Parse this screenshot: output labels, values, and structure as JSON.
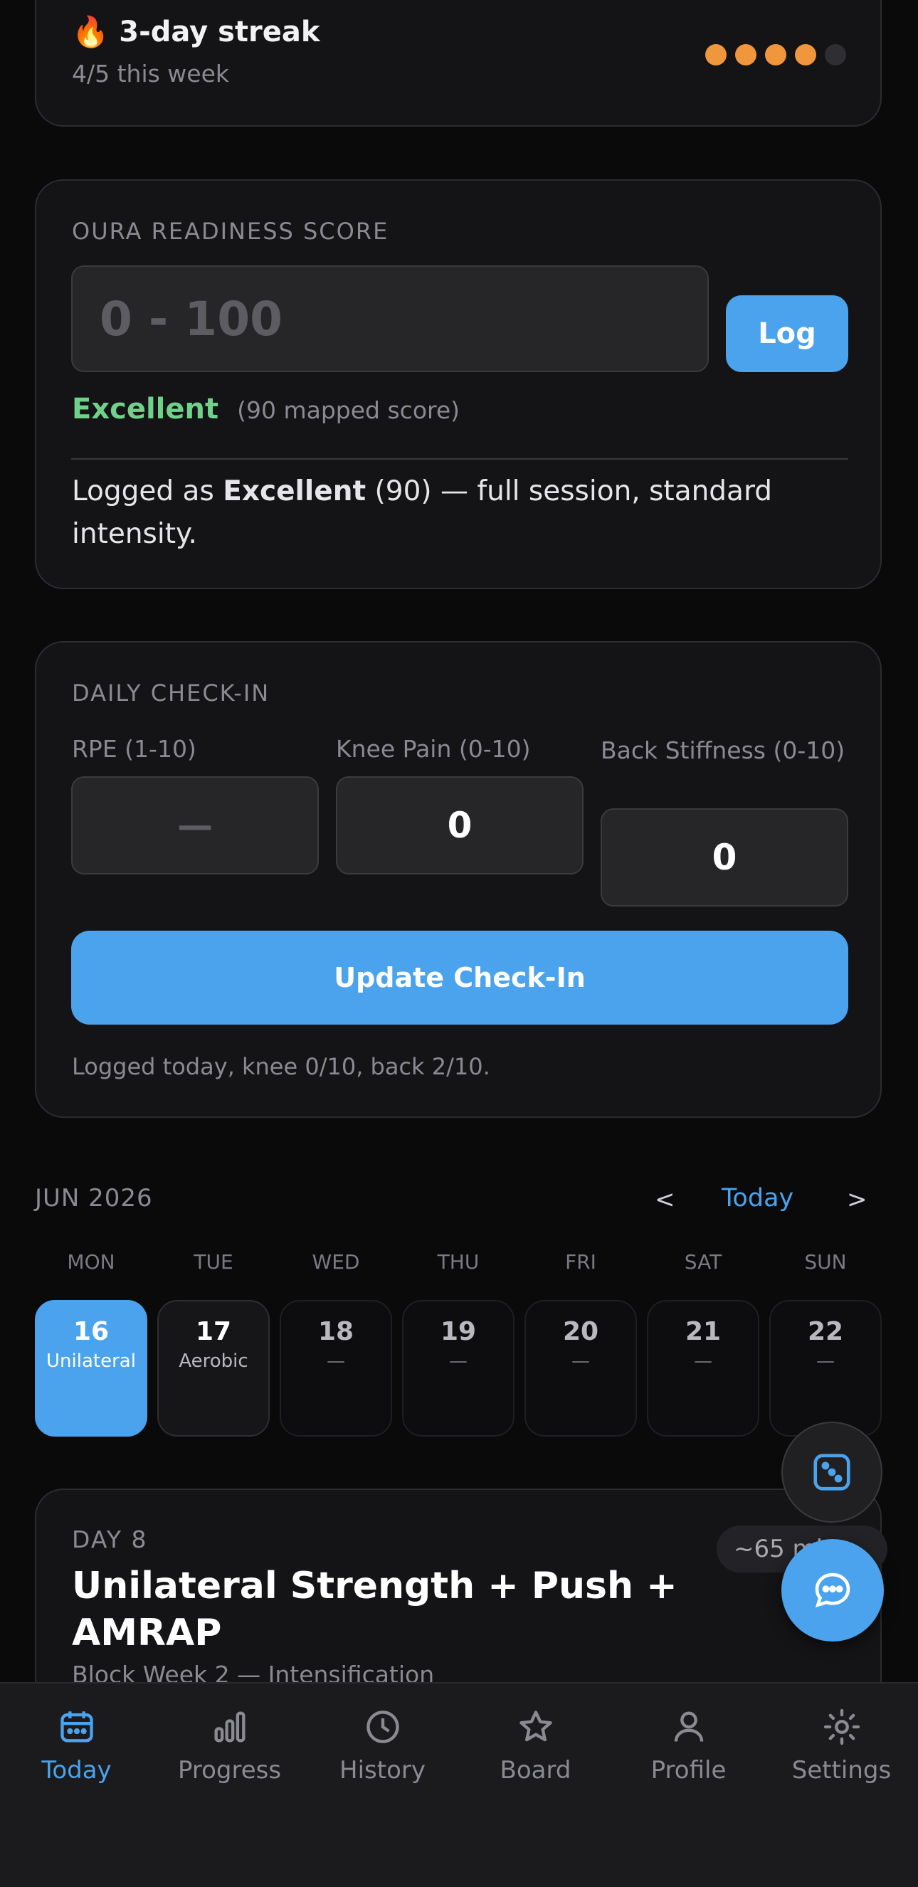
{
  "streak": {
    "emoji": "🔥",
    "title": "3-day streak",
    "subtitle": "4/5 this week",
    "dots_filled": 4,
    "dots_total": 5,
    "dot_color": "#f0963c"
  },
  "readiness": {
    "heading": "OURA READINESS SCORE",
    "input_placeholder": "0 - 100",
    "log_label": "Log",
    "rating": "Excellent",
    "rating_color": "#6fd18a",
    "mapped": "(90 mapped score)",
    "logged_prefix": "Logged as ",
    "logged_rating": "Excellent",
    "logged_suffix": " (90) — full session, standard intensity."
  },
  "checkin": {
    "heading": "DAILY CHECK-IN",
    "rpe_label": "RPE (1-10)",
    "rpe_value": "—",
    "knee_label": "Knee Pain (0-10)",
    "knee_value": "0",
    "back_label": "Back Stiffness (0-10)",
    "back_value": "0",
    "button_label": "Update Check-In",
    "status": "Logged today, knee 0/10, back 2/10."
  },
  "calendar": {
    "month": "JUN 2026",
    "prev": "<",
    "today_label": "Today",
    "next": ">",
    "weekdays": [
      "MON",
      "TUE",
      "WED",
      "THU",
      "FRI",
      "SAT",
      "SUN"
    ],
    "days": [
      {
        "num": "16",
        "sub": "Unilateral",
        "selected": true
      },
      {
        "num": "17",
        "sub": "Aerobic"
      },
      {
        "num": "18",
        "sub": "—"
      },
      {
        "num": "19",
        "sub": "—"
      },
      {
        "num": "20",
        "sub": "—"
      },
      {
        "num": "21",
        "sub": "—"
      },
      {
        "num": "22",
        "sub": "—"
      }
    ]
  },
  "workout": {
    "day_label": "DAY 8",
    "title_line1": "Unilateral Strength + Push +",
    "title_line2": "AMRAP",
    "duration": "~65 min",
    "block": "Block Week 2 — Intensification"
  },
  "fab": {
    "dice_icon": "dice-icon",
    "chat_icon": "chat-icon"
  },
  "nav": {
    "items": [
      {
        "label": "Today",
        "icon": "calendar-icon",
        "active": true
      },
      {
        "label": "Progress",
        "icon": "bar-chart-icon"
      },
      {
        "label": "History",
        "icon": "clock-icon"
      },
      {
        "label": "Board",
        "icon": "star-icon"
      },
      {
        "label": "Profile",
        "icon": "person-icon"
      },
      {
        "label": "Settings",
        "icon": "gear-icon"
      }
    ]
  },
  "colors": {
    "accent": "#4aa3ec",
    "background": "#0a0a0b",
    "card": "#141416"
  }
}
